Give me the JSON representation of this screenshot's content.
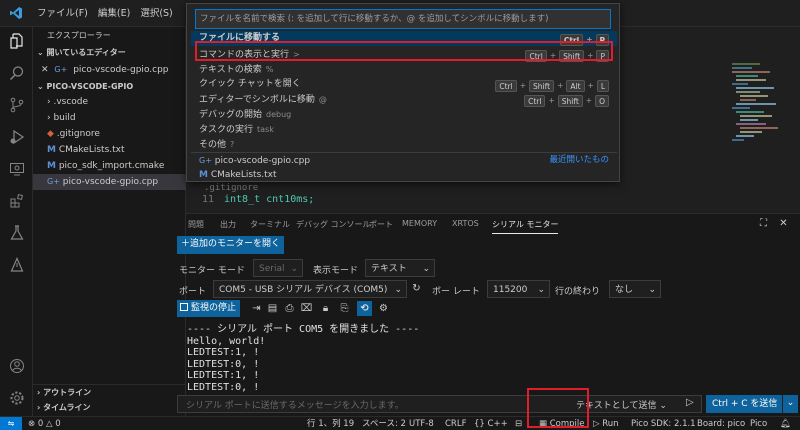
{
  "menu": [
    "ファイル(F)",
    "編集(E)",
    "選択(S)"
  ],
  "sidebar": {
    "title": "エクスプローラー",
    "open_editors_header": "開いているエディター",
    "open_file": "pico-vscode-gpio.cpp",
    "project_header": "PICO-VSCODE-GPIO",
    "items": [
      ".vscode",
      "build",
      ".gitignore",
      "CMakeLists.txt",
      "pico_sdk_import.cmake",
      "pico-vscode-gpio.cpp"
    ],
    "outline": "アウトライン",
    "timeline": "タイムライン"
  },
  "palette": {
    "placeholder": "ファイルを名前で検索 (: を追加して行に移動するか、@ を追加してシンボルに移動します)",
    "rows": [
      {
        "label": "ファイルに移動する",
        "sub": "",
        "keys": [
          "Ctrl",
          "P"
        ]
      },
      {
        "label": "コマンドの表示と実行",
        "sub": ">",
        "keys": [
          "Ctrl",
          "Shift",
          "P"
        ]
      },
      {
        "label": "テキストの検索",
        "sub": "%",
        "keys": []
      },
      {
        "label": "クイック チャットを開く",
        "sub": "",
        "keys": [
          "Ctrl",
          "Shift",
          "Alt",
          "L"
        ]
      },
      {
        "label": "エディターでシンボルに移動",
        "sub": "@",
        "keys": [
          "Ctrl",
          "Shift",
          "O"
        ]
      },
      {
        "label": "デバッグの開始",
        "sub": "debug",
        "keys": []
      },
      {
        "label": "タスクの実行",
        "sub": "task",
        "keys": []
      },
      {
        "label": "その他",
        "sub": "?",
        "keys": []
      }
    ],
    "recent_files": [
      "pico-vscode-gpio.cpp",
      "CMakeLists.txt"
    ],
    "recent_label": "最近開いたもの"
  },
  "editor": {
    "behind_text": ".gitignore",
    "line_number": "11",
    "line_code": "int8_t cnt10ms;"
  },
  "panel": {
    "tabs": [
      "問題",
      "出力",
      "ターミナル",
      "デバッグ コンソール",
      "ポート",
      "MEMORY",
      "XRTOS",
      "シリアル モニター"
    ],
    "add_monitor": "＋追加のモニターを開く",
    "monitor_mode_label": "モニター モード",
    "monitor_mode_value": "Serial",
    "display_mode_label": "表示モード",
    "display_mode_value": "テキスト",
    "port_label": "ポート",
    "port_value": "COM5 - USB シリアル デバイス (COM5)",
    "baud_label": "ボー レート",
    "baud_value": "115200",
    "line_end_label": "行の終わり",
    "line_end_value": "なし",
    "stop_button": "監視の停止",
    "output_lines": [
      "---- シリアル ポート COM5 を開きました ----",
      "Hello, world!",
      "LEDTEST:1, !",
      "LEDTEST:0, !",
      "LEDTEST:1, !",
      "LEDTEST:0, !"
    ],
    "send_placeholder": "シリアル ポートに送信するメッセージを入力します。",
    "send_as": "テキストとして送信",
    "ctrl_c_button": "Ctrl + C を送信"
  },
  "status": {
    "errors": "0",
    "warnings": "0",
    "position": "行 1、列 19",
    "spaces": "スペース: 2",
    "encoding": "UTF-8",
    "eol": "CRLF",
    "language": "C++",
    "compile": "Compile",
    "run": "Run",
    "sdk": "Pico SDK: 2.1.1",
    "board": "Board: pico",
    "pico": "Pico"
  },
  "colors": {
    "accent": "#0e639c",
    "highlight": "#e01e2b",
    "selection": "#04395e"
  }
}
